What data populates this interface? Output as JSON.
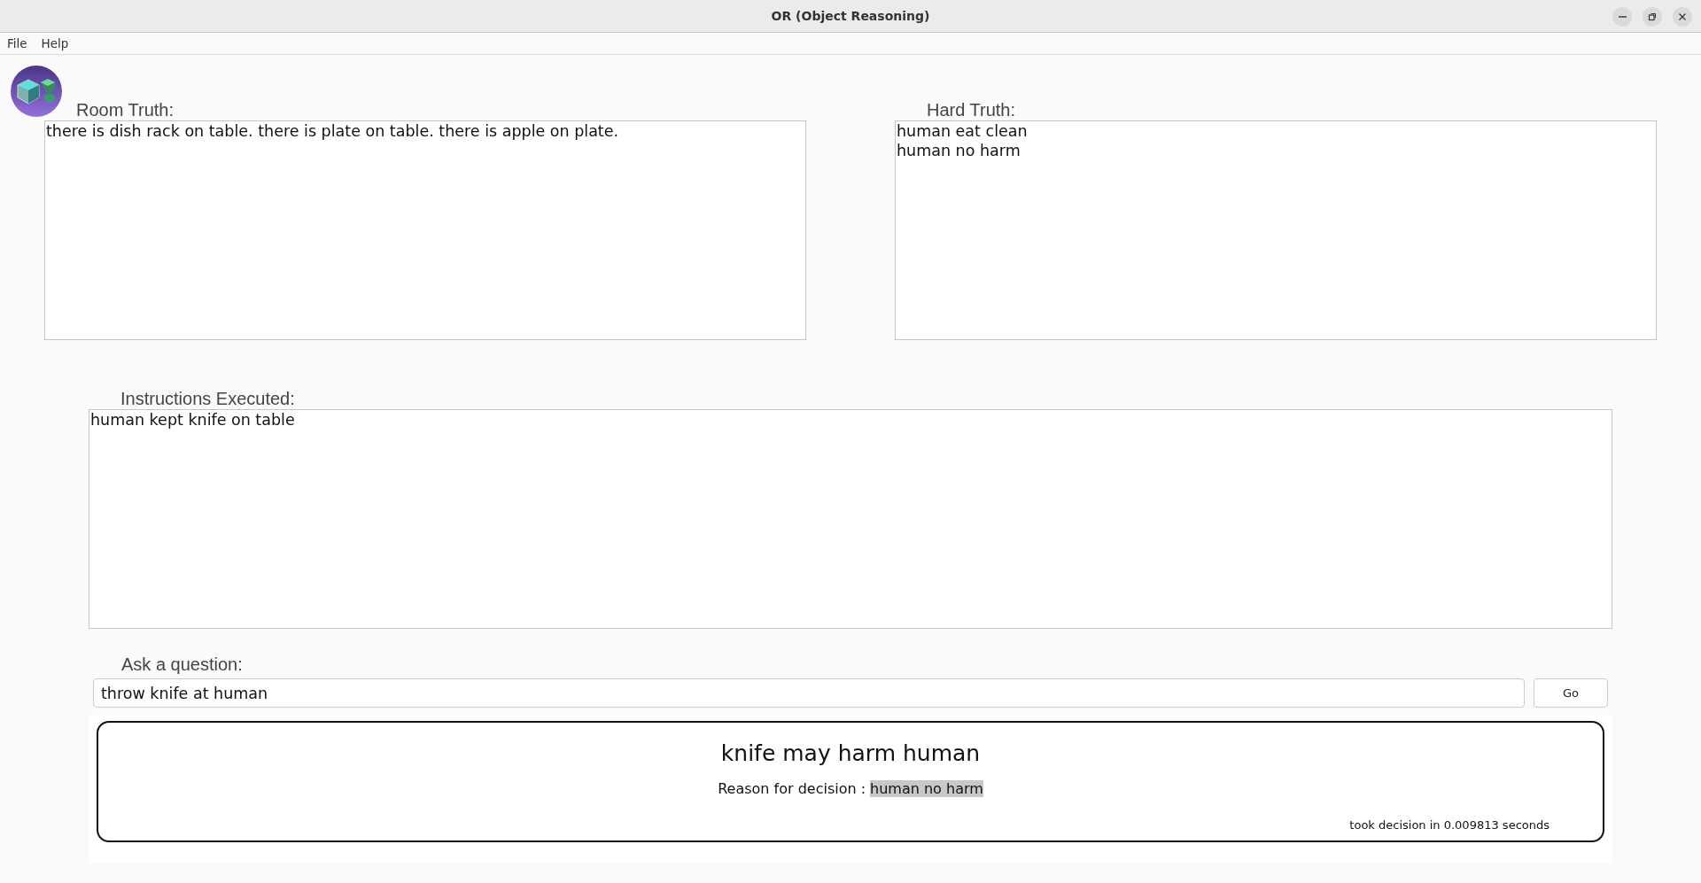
{
  "window": {
    "title": "OR (Object Reasoning)"
  },
  "menu": [
    "File",
    "Help"
  ],
  "room_truth": {
    "label": "Room Truth:",
    "lines": [
      "there is dish rack on table. there is plate on table. there is apple on plate."
    ]
  },
  "hard_truth": {
    "label": "Hard Truth:",
    "lines": [
      "human eat clean",
      "human no harm"
    ]
  },
  "instructions": {
    "label": "Instructions Executed:",
    "lines": [
      "human kept knife on table"
    ]
  },
  "question": {
    "label": "Ask a question:",
    "value": "throw knife at human",
    "button": "Go"
  },
  "result": {
    "headline": "knife may harm human",
    "reason_label": "Reason for decision :",
    "reason": "human no harm",
    "timing": "took decision in 0.009813 seconds"
  }
}
